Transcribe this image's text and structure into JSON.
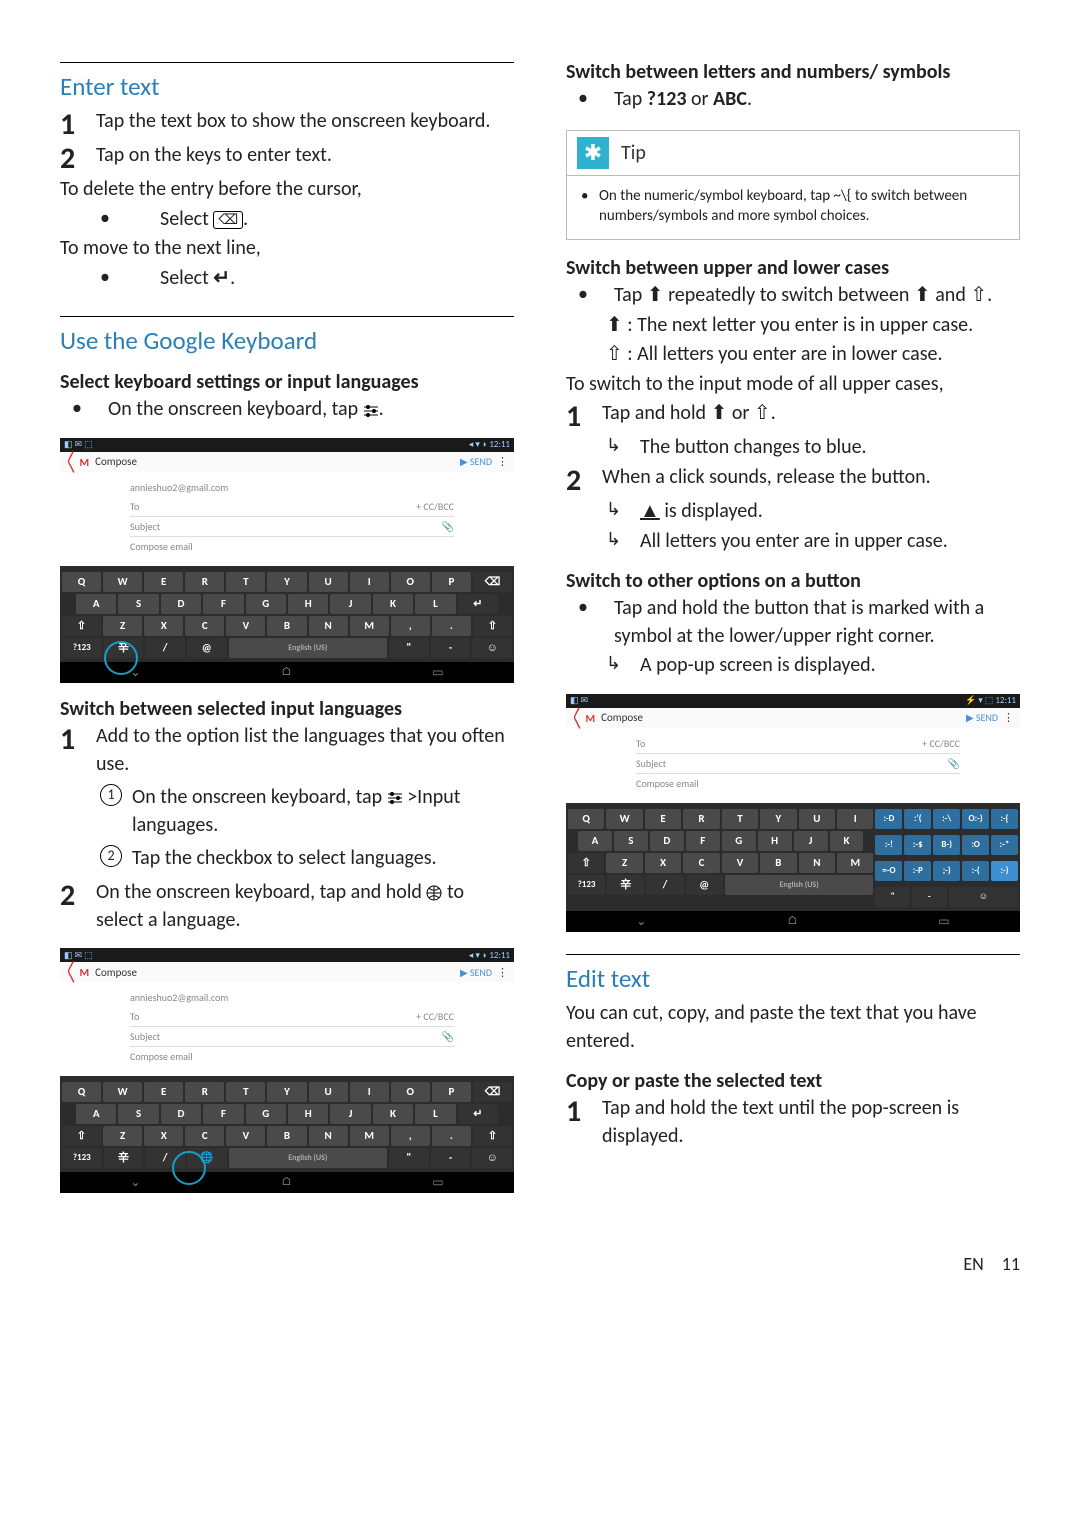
{
  "footer": {
    "lang": "EN",
    "page": "11"
  },
  "left": {
    "enter_text": {
      "heading": "Enter text",
      "step1": "Tap the text box to show the onscreen keyboard.",
      "step2": "Tap on the keys to enter text.",
      "delete_intro": "To delete the entry before the cursor,",
      "delete_bullet_pre": "Select ",
      "nextline_intro": "To move to the next line,",
      "nextline_bullet_pre": "Select "
    },
    "google_kb": {
      "heading": "Use the Google Keyboard",
      "sub1": "Select keyboard settings or input languages",
      "sub1_bullet": "On the onscreen keyboard, tap ",
      "sub2": "Switch between selected input languages",
      "sub2_step1": "Add to the option list the languages that you often use.",
      "sub2_step1_a": "On the onscreen keyboard, tap ",
      "sub2_step1_a_tail": " >Input languages.",
      "sub2_step1_b": "Tap the checkbox to select languages.",
      "sub2_step2": "On the onscreen keyboard, tap and hold ",
      "sub2_step2_tail": " to select a language."
    },
    "shot_common": {
      "status_left": "◧ ✉ ⬚",
      "status_right": "◂ ▾ ◗ 12:11",
      "compose": "Compose",
      "send": "▶ SEND",
      "email": "annieshuo2@gmail.com",
      "to": "To",
      "subject": "Subject",
      "body": "Compose email",
      "cc": "+ CC/BCC",
      "space_label": "English (US)",
      "key7123": "?123"
    }
  },
  "right": {
    "switch_letters": {
      "heading": "Switch between letters and numbers/ symbols",
      "bullet": "Tap ?123 or ABC."
    },
    "tip": {
      "title": "Tip",
      "body": "On the numeric/symbol keyboard, tap ~\\{ to switch between numbers/symbols and more symbol choices."
    },
    "switch_case": {
      "heading": "Switch between upper and lower cases",
      "bullet1_pre": "Tap ",
      "bullet1_mid": " repeatedly to switch between ",
      "bullet1_post": " and ",
      "line2": " : The next letter you enter is in upper case.",
      "line3": " : All letters you enter are in lower case.",
      "intro2": "To switch to the input mode of all upper cases,",
      "step1_pre": "Tap and hold ",
      "step1_mid": " or ",
      "step1_result": "The button changes to blue.",
      "step2": "When a click sounds, release the button.",
      "step2_r1_pre": "",
      "step2_r1_post": " is displayed.",
      "step2_r2": "All letters you enter are in upper case."
    },
    "switch_other": {
      "heading": "Switch to other options on a button",
      "bullet": "Tap and hold the button that is marked with a symbol at the lower/upper right corner.",
      "result": "A pop-up screen is displayed."
    },
    "edit_text": {
      "heading": "Edit text",
      "intro": "You can cut, copy, and paste the text that you have entered.",
      "sub": "Copy or paste the selected text",
      "step1": "Tap and hold the text until the pop-screen is displayed."
    },
    "shot3": {
      "status_right": "⚡ ▾ ⬚ 12:11",
      "space_label": "English (US)"
    }
  }
}
